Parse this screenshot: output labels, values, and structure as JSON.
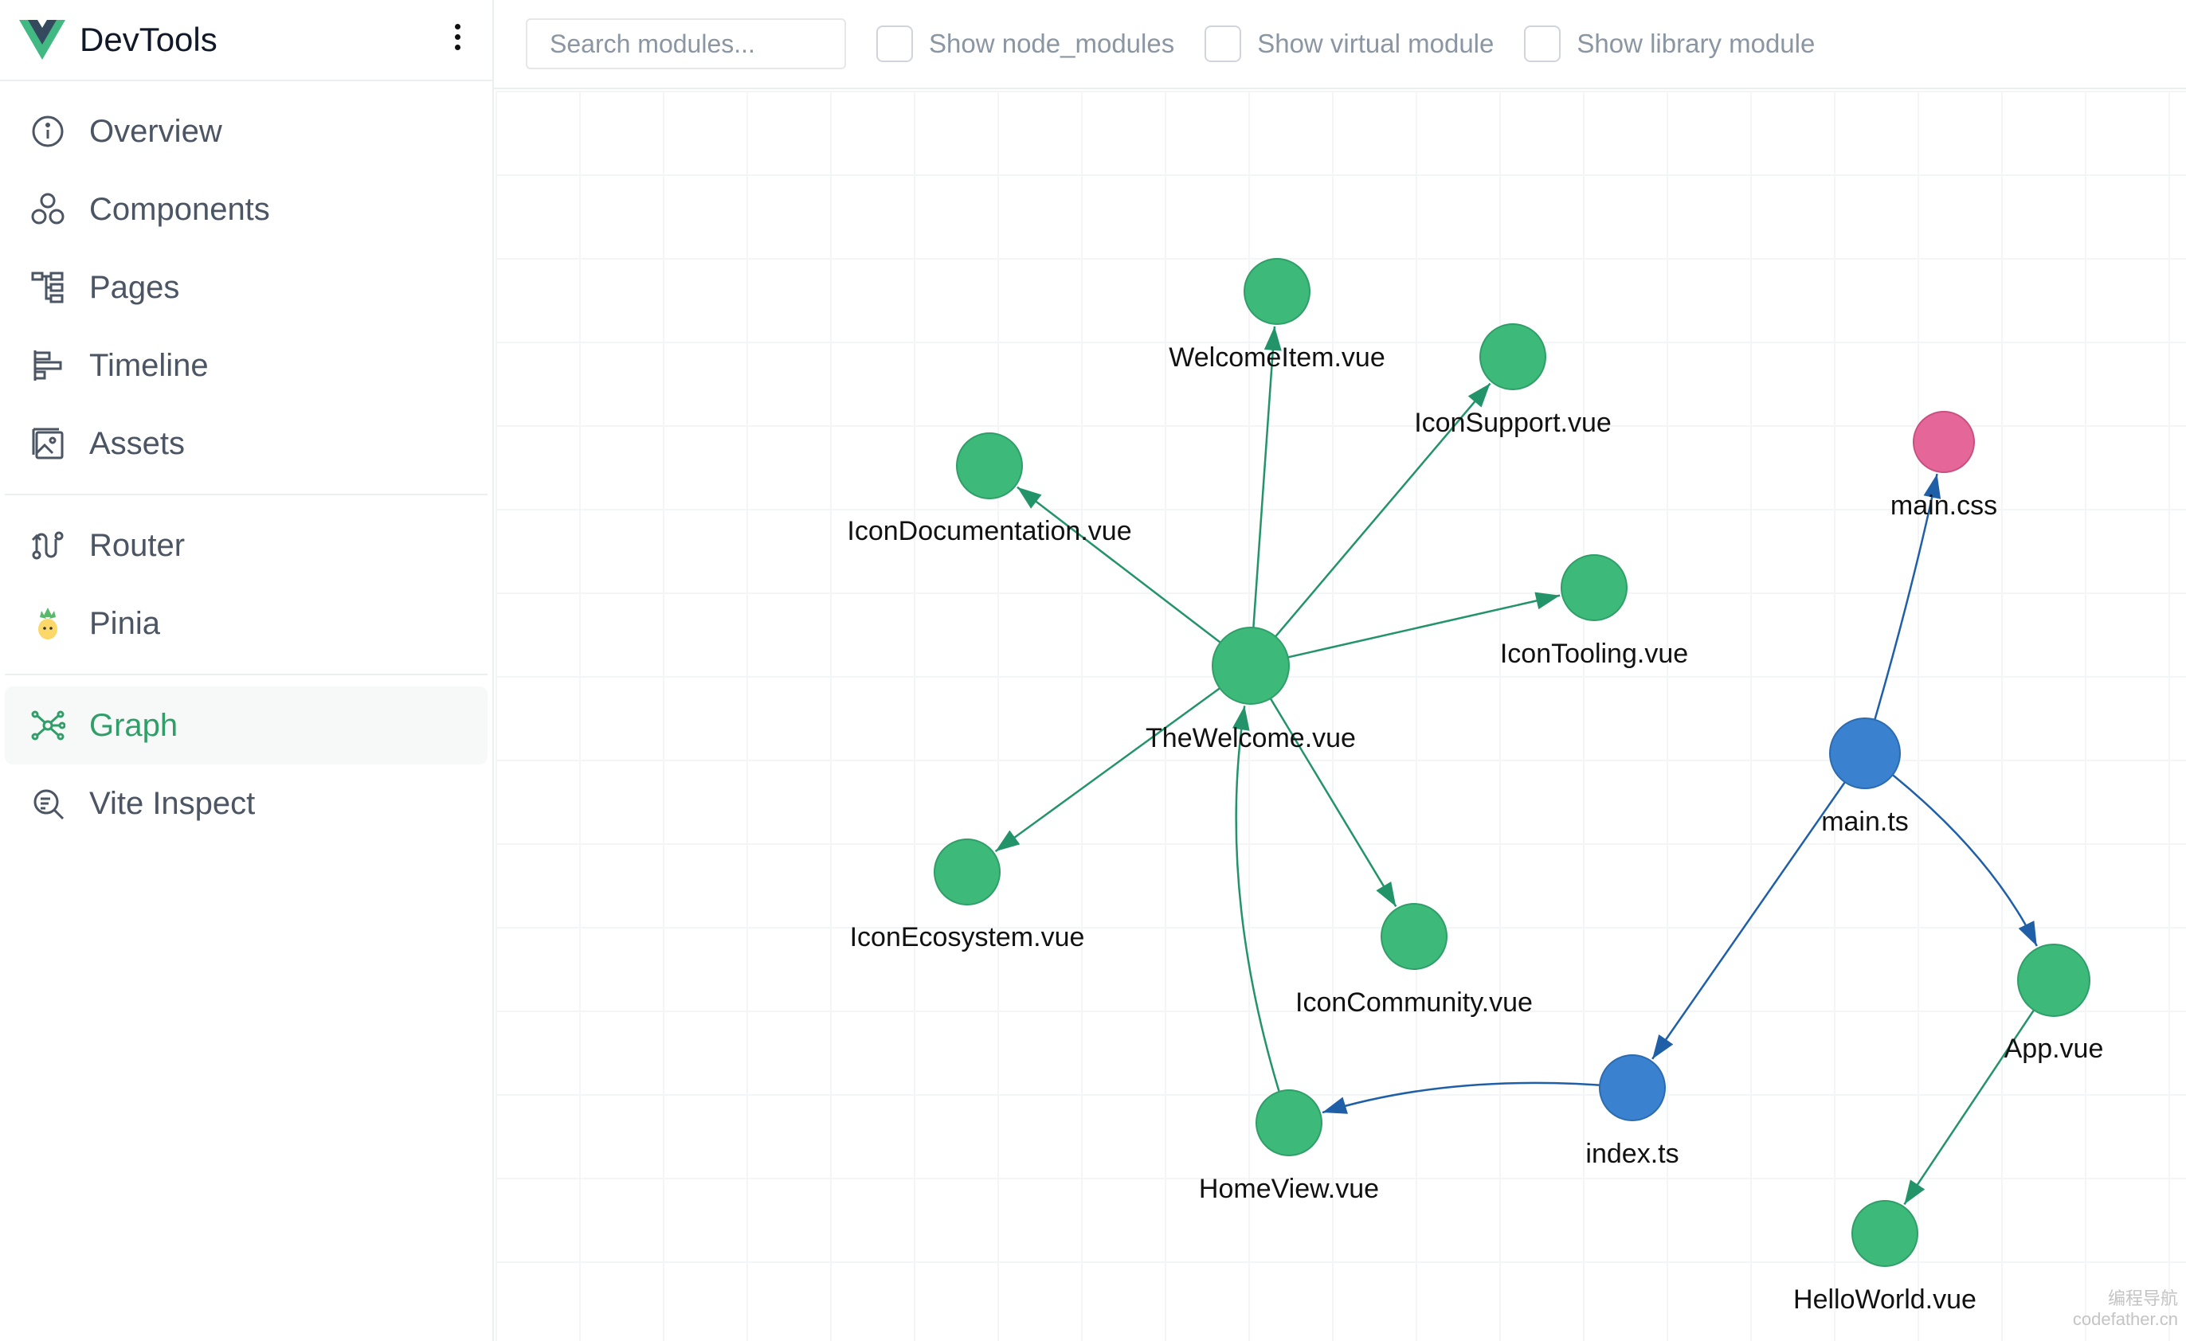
{
  "app": {
    "title": "DevTools"
  },
  "sidebar": {
    "groups": [
      [
        {
          "label": "Overview",
          "icon": "info-circle-icon"
        },
        {
          "label": "Components",
          "icon": "hexagons-icon"
        },
        {
          "label": "Pages",
          "icon": "tree-icon"
        },
        {
          "label": "Timeline",
          "icon": "timeline-icon"
        },
        {
          "label": "Assets",
          "icon": "image-icon"
        }
      ],
      [
        {
          "label": "Router",
          "icon": "route-icon"
        },
        {
          "label": "Pinia",
          "icon": "pineapple-icon"
        }
      ],
      [
        {
          "label": "Graph",
          "icon": "graph-icon",
          "active": true
        },
        {
          "label": "Vite Inspect",
          "icon": "inspect-icon"
        }
      ]
    ]
  },
  "toolbar": {
    "search_placeholder": "Search modules...",
    "search_value": "",
    "checkboxes": [
      {
        "label": "Show node_modules",
        "checked": false
      },
      {
        "label": "Show virtual module",
        "checked": false
      },
      {
        "label": "Show library module",
        "checked": false
      }
    ]
  },
  "graph": {
    "colors": {
      "vue": "#3dba7a",
      "ts": "#3a82d0",
      "css": "#e5679a",
      "edge_vue": "#23936a",
      "edge_ts": "#1f5fa8"
    },
    "nodes": [
      {
        "id": "TheWelcome.vue",
        "type": "vue"
      },
      {
        "id": "WelcomeItem.vue",
        "type": "vue"
      },
      {
        "id": "IconSupport.vue",
        "type": "vue"
      },
      {
        "id": "IconDocumentation.vue",
        "type": "vue"
      },
      {
        "id": "IconTooling.vue",
        "type": "vue"
      },
      {
        "id": "IconEcosystem.vue",
        "type": "vue"
      },
      {
        "id": "IconCommunity.vue",
        "type": "vue"
      },
      {
        "id": "HomeView.vue",
        "type": "vue"
      },
      {
        "id": "main.css",
        "type": "css"
      },
      {
        "id": "main.ts",
        "type": "ts"
      },
      {
        "id": "index.ts",
        "type": "ts"
      },
      {
        "id": "App.vue",
        "type": "vue"
      },
      {
        "id": "HelloWorld.vue",
        "type": "vue"
      }
    ],
    "edges": [
      {
        "from": "TheWelcome.vue",
        "to": "WelcomeItem.vue"
      },
      {
        "from": "TheWelcome.vue",
        "to": "IconSupport.vue"
      },
      {
        "from": "TheWelcome.vue",
        "to": "IconDocumentation.vue"
      },
      {
        "from": "TheWelcome.vue",
        "to": "IconTooling.vue"
      },
      {
        "from": "TheWelcome.vue",
        "to": "IconEcosystem.vue"
      },
      {
        "from": "TheWelcome.vue",
        "to": "IconCommunity.vue"
      },
      {
        "from": "HomeView.vue",
        "to": "TheWelcome.vue"
      },
      {
        "from": "index.ts",
        "to": "HomeView.vue"
      },
      {
        "from": "main.ts",
        "to": "main.css"
      },
      {
        "from": "main.ts",
        "to": "index.ts"
      },
      {
        "from": "main.ts",
        "to": "App.vue"
      },
      {
        "from": "App.vue",
        "to": "HelloWorld.vue"
      }
    ]
  },
  "watermark": {
    "line1": "编程导航",
    "line2": "codefather.cn"
  }
}
